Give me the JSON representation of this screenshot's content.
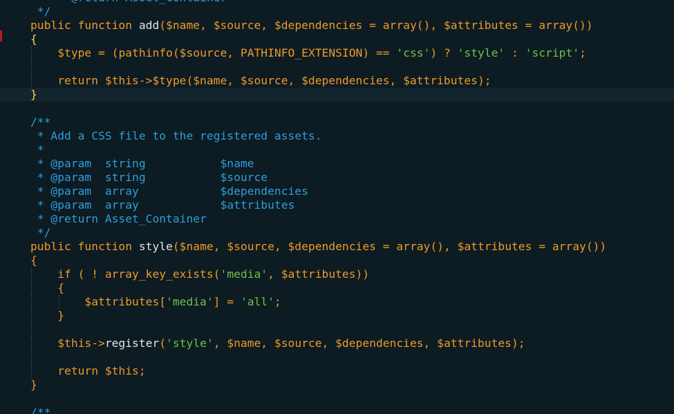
{
  "editor": {
    "lines": [
      {
        "guides": [],
        "tokens": [
          {
            "t": "    * @return Asset_Container",
            "c": "cm"
          }
        ]
      },
      {
        "guides": [],
        "tokens": [
          {
            "t": " */",
            "c": "cm"
          }
        ]
      },
      {
        "guides": [],
        "tokens": [
          {
            "t": "public function ",
            "c": "kw"
          },
          {
            "t": "add",
            "c": "fn"
          },
          {
            "t": "(",
            "c": "pun"
          },
          {
            "t": "$name, $source, $dependencies = ",
            "c": "var"
          },
          {
            "t": "array",
            "c": "kw"
          },
          {
            "t": "(), ",
            "c": "pun"
          },
          {
            "t": "$attributes = ",
            "c": "var"
          },
          {
            "t": "array",
            "c": "kw"
          },
          {
            "t": "())",
            "c": "pun"
          }
        ]
      },
      {
        "guides": [],
        "tokens": [
          {
            "t": "{",
            "c": "br-hl"
          }
        ]
      },
      {
        "guides": [
          0
        ],
        "tokens": [
          {
            "t": "    $type = (",
            "c": "var"
          },
          {
            "t": "pathinfo",
            "c": "kw"
          },
          {
            "t": "($source, ",
            "c": "var"
          },
          {
            "t": "PATHINFO_EXTENSION",
            "c": "const"
          },
          {
            "t": ") == ",
            "c": "pun"
          },
          {
            "t": "'css'",
            "c": "str"
          },
          {
            "t": ") ? ",
            "c": "pun"
          },
          {
            "t": "'style'",
            "c": "str"
          },
          {
            "t": " : ",
            "c": "pun"
          },
          {
            "t": "'script'",
            "c": "str"
          },
          {
            "t": ";",
            "c": "pun"
          }
        ]
      },
      {
        "guides": [
          0
        ],
        "tokens": []
      },
      {
        "guides": [
          0
        ],
        "tokens": [
          {
            "t": "    return ",
            "c": "kw"
          },
          {
            "t": "$this->$type($name, $source, $dependencies, $attributes);",
            "c": "var"
          }
        ]
      },
      {
        "guides": [],
        "active": true,
        "tokens": [
          {
            "t": "}",
            "c": "br-hl"
          }
        ]
      },
      {
        "guides": [],
        "tokens": []
      },
      {
        "guides": [],
        "tokens": [
          {
            "t": "/**",
            "c": "cm"
          }
        ]
      },
      {
        "guides": [],
        "tokens": [
          {
            "t": " * Add a CSS file to the registered assets.",
            "c": "cm"
          }
        ]
      },
      {
        "guides": [],
        "tokens": [
          {
            "t": " *",
            "c": "cm"
          }
        ]
      },
      {
        "guides": [],
        "tokens": [
          {
            "t": " * @param  string           ",
            "c": "cm"
          },
          {
            "t": "$name",
            "c": "cm-var"
          }
        ]
      },
      {
        "guides": [],
        "tokens": [
          {
            "t": " * @param  string           ",
            "c": "cm"
          },
          {
            "t": "$source",
            "c": "cm-var"
          }
        ]
      },
      {
        "guides": [],
        "tokens": [
          {
            "t": " * @param  array            ",
            "c": "cm"
          },
          {
            "t": "$dependencies",
            "c": "cm-var"
          }
        ]
      },
      {
        "guides": [],
        "tokens": [
          {
            "t": " * @param  array            ",
            "c": "cm"
          },
          {
            "t": "$attributes",
            "c": "cm-var"
          }
        ]
      },
      {
        "guides": [],
        "tokens": [
          {
            "t": " * @return Asset_Container",
            "c": "cm"
          }
        ]
      },
      {
        "guides": [],
        "tokens": [
          {
            "t": " */",
            "c": "cm"
          }
        ]
      },
      {
        "guides": [],
        "tokens": [
          {
            "t": "public function ",
            "c": "kw"
          },
          {
            "t": "style",
            "c": "fn"
          },
          {
            "t": "(",
            "c": "pun"
          },
          {
            "t": "$name, $source, $dependencies = ",
            "c": "var"
          },
          {
            "t": "array",
            "c": "kw"
          },
          {
            "t": "(), ",
            "c": "pun"
          },
          {
            "t": "$attributes = ",
            "c": "var"
          },
          {
            "t": "array",
            "c": "kw"
          },
          {
            "t": "())",
            "c": "pun"
          }
        ]
      },
      {
        "guides": [],
        "tokens": [
          {
            "t": "{",
            "c": "pun"
          }
        ]
      },
      {
        "guides": [
          0
        ],
        "tokens": [
          {
            "t": "    if ( ! ",
            "c": "kw"
          },
          {
            "t": "array_key_exists",
            "c": "kw"
          },
          {
            "t": "(",
            "c": "pun"
          },
          {
            "t": "'media'",
            "c": "str"
          },
          {
            "t": ", $attributes))",
            "c": "var"
          }
        ]
      },
      {
        "guides": [
          0
        ],
        "tokens": [
          {
            "t": "    {",
            "c": "pun"
          }
        ]
      },
      {
        "guides": [
          0,
          1
        ],
        "tokens": [
          {
            "t": "        $attributes[",
            "c": "var"
          },
          {
            "t": "'media'",
            "c": "str"
          },
          {
            "t": "] = ",
            "c": "pun"
          },
          {
            "t": "'all'",
            "c": "str"
          },
          {
            "t": ";",
            "c": "pun"
          }
        ]
      },
      {
        "guides": [
          0
        ],
        "tokens": [
          {
            "t": "    }",
            "c": "pun"
          }
        ]
      },
      {
        "guides": [
          0
        ],
        "tokens": []
      },
      {
        "guides": [
          0
        ],
        "tokens": [
          {
            "t": "    $this->",
            "c": "var"
          },
          {
            "t": "register",
            "c": "fn"
          },
          {
            "t": "(",
            "c": "pun"
          },
          {
            "t": "'style'",
            "c": "str"
          },
          {
            "t": ", $name, $source, $dependencies, $attributes);",
            "c": "var"
          }
        ]
      },
      {
        "guides": [
          0
        ],
        "tokens": []
      },
      {
        "guides": [
          0
        ],
        "tokens": [
          {
            "t": "    return ",
            "c": "kw"
          },
          {
            "t": "$this;",
            "c": "var"
          }
        ]
      },
      {
        "guides": [],
        "tokens": [
          {
            "t": "}",
            "c": "pun"
          }
        ]
      },
      {
        "guides": [],
        "tokens": []
      },
      {
        "guides": [],
        "tokens": [
          {
            "t": "/**",
            "c": "cm"
          }
        ]
      }
    ]
  },
  "colors": {
    "background": "#0d1b22",
    "keyword": "#ee9a2a",
    "string": "#71c149",
    "comment": "#2f9fdc",
    "function_name": "#e6e6e6",
    "bracket_highlight": "#ffd54a",
    "error_marker": "#b01e2a"
  }
}
